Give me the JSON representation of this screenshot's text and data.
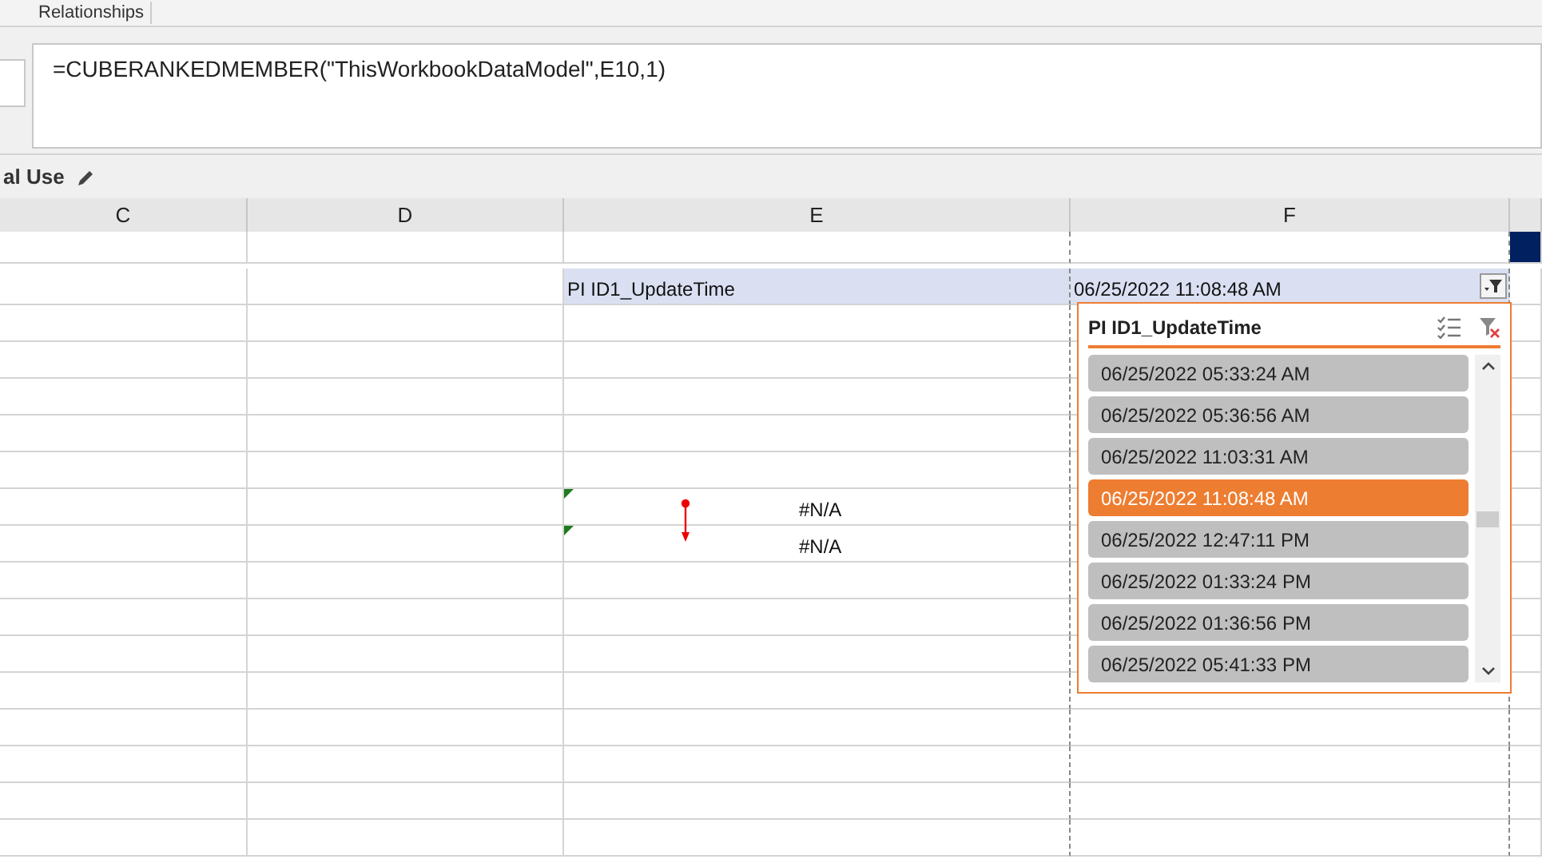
{
  "ribbon_tab": "Relationships",
  "formula_bar": {
    "formula": "=CUBERANKEDMEMBER(\"ThisWorkbookDataModel\",E10,1)"
  },
  "sheet_label": "al Use",
  "columns": [
    "C",
    "D",
    "E",
    "F"
  ],
  "header_row": {
    "e": "PI ID1_UpdateTime",
    "f": "06/25/2022 11:08:48 AM"
  },
  "error_rows": [
    {
      "value": "#N/A"
    },
    {
      "value": "#N/A"
    }
  ],
  "slicer": {
    "title": "PI ID1_UpdateTime",
    "items": [
      {
        "label": "06/25/2022 05:33:24 AM",
        "selected": false
      },
      {
        "label": "06/25/2022 05:36:56 AM",
        "selected": false
      },
      {
        "label": "06/25/2022 11:03:31 AM",
        "selected": false
      },
      {
        "label": "06/25/2022 11:08:48 AM",
        "selected": true
      },
      {
        "label": "06/25/2022 12:47:11 PM",
        "selected": false
      },
      {
        "label": "06/25/2022 01:33:24 PM",
        "selected": false
      },
      {
        "label": "06/25/2022 01:36:56 PM",
        "selected": false
      },
      {
        "label": "06/25/2022 05:41:33 PM",
        "selected": false
      }
    ]
  }
}
